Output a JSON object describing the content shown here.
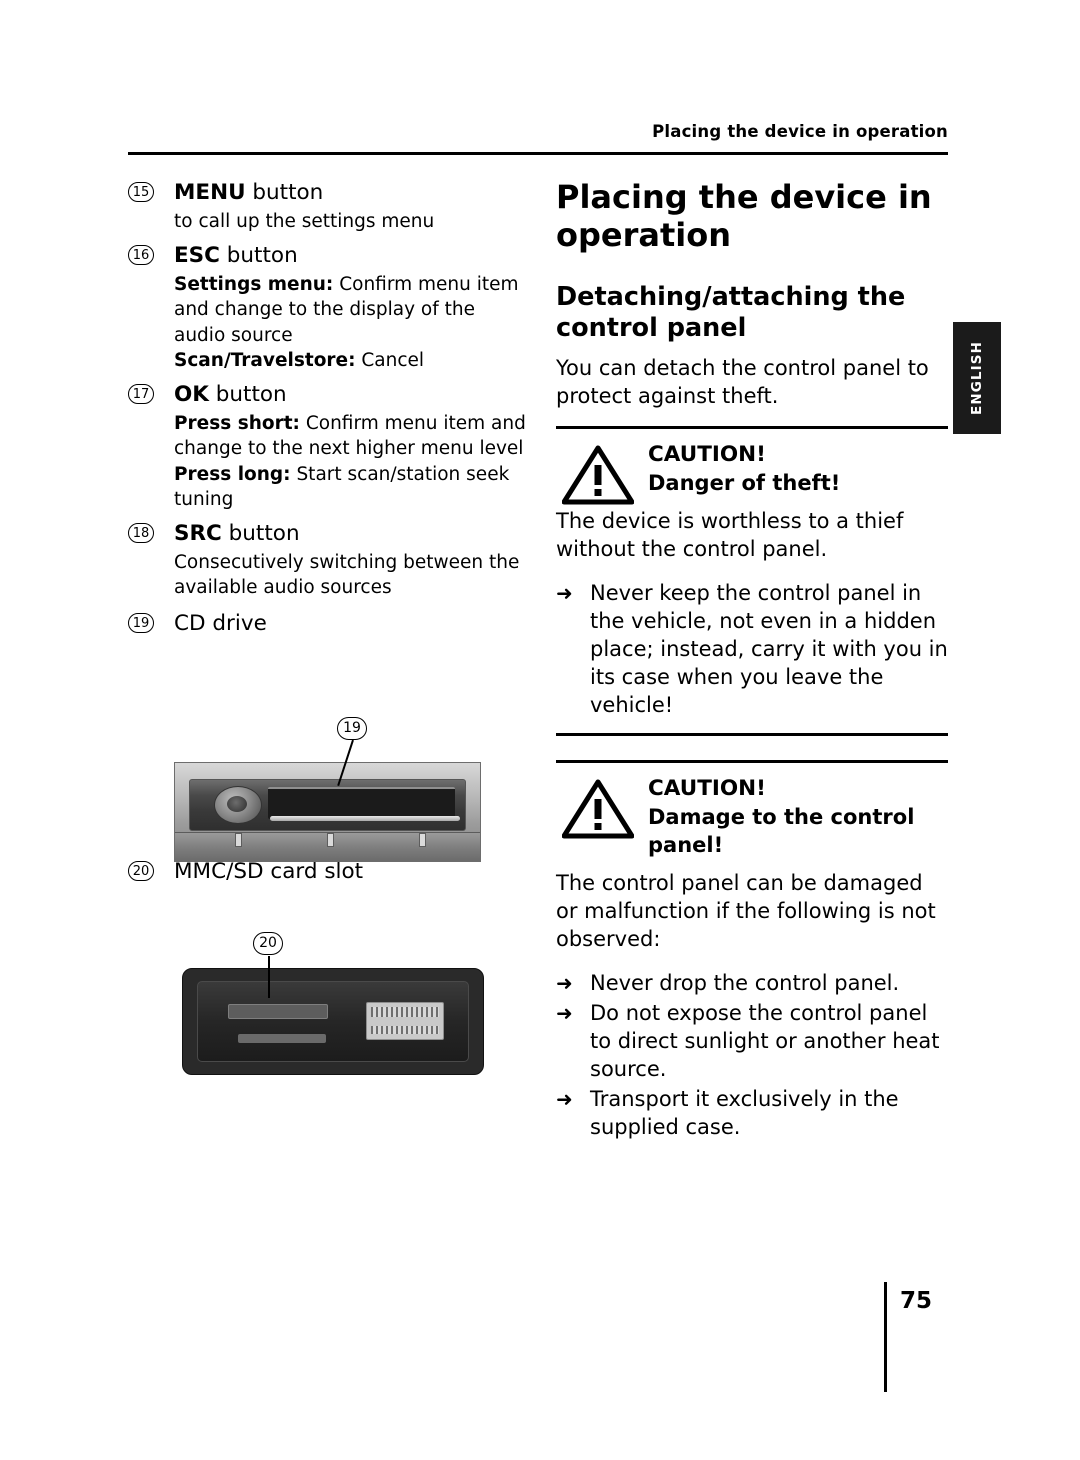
{
  "header": {
    "running_head": "Placing the device in operation"
  },
  "lang_tab": {
    "label": "ENGLISH"
  },
  "left_column": {
    "items": [
      {
        "num": "15",
        "title_bold": "MENU",
        "title_rest": " button",
        "body": "to call up the settings menu"
      },
      {
        "num": "16",
        "title_bold": "ESC",
        "title_rest": " button",
        "line1_bold": "Settings menu:",
        "line1_rest": " Confirm menu item and change to the display of the audio source",
        "line2_bold": "Scan/Travelstore:",
        "line2_rest": " Cancel"
      },
      {
        "num": "17",
        "title_bold": "OK",
        "title_rest": " button",
        "line1_bold": "Press short:",
        "line1_rest": " Confirm menu item and change to the next higher menu level",
        "line2_bold": "Press long:",
        "line2_rest": " Start scan/station seek tuning"
      },
      {
        "num": "18",
        "title_bold": "SRC",
        "title_rest": " button",
        "body": "Consecutively switching between the available audio sources"
      },
      {
        "num": "19",
        "title_bold": "",
        "title_rest": "CD drive"
      },
      {
        "num": "20",
        "title_bold": "",
        "title_rest": "MMC/SD card slot"
      }
    ],
    "figure_cd_callout": "19",
    "figure_mmc_callout": "20"
  },
  "right_column": {
    "h1": "Placing the device in operation",
    "h2": "Detaching/attaching the control panel",
    "intro": "You can detach the control panel to protect against theft.",
    "caution1": {
      "title": "CAUTION!",
      "subtitle": "Danger of theft!",
      "body": "The device is worthless to a thief without the control panel.",
      "bullets": [
        "Never keep the control panel in the vehicle, not even in a hidden place; instead, carry it with you in its case when you leave the vehicle!"
      ]
    },
    "caution2": {
      "title": "CAUTION!",
      "subtitle": "Damage to the control panel!",
      "body": "The control panel can be damaged or malfunction if the following is not observed:",
      "bullets": [
        "Never drop the control panel.",
        "Do not expose the control panel to direct sunlight or another heat source.",
        "Transport it exclusively in the supplied case."
      ]
    },
    "arrow_glyph": "➜"
  },
  "footer": {
    "page_number": "75"
  }
}
